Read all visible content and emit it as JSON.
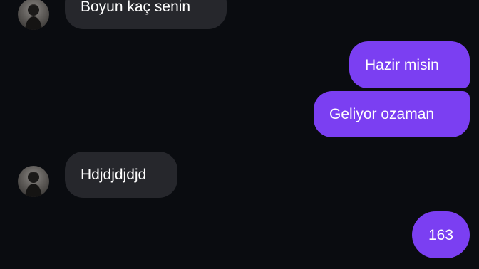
{
  "conversation": {
    "messages": [
      {
        "direction": "incoming",
        "text": "Boyun kaç senin"
      },
      {
        "direction": "outgoing",
        "text": "Hazir misin"
      },
      {
        "direction": "outgoing",
        "text": "Geliyor ozaman"
      },
      {
        "direction": "incoming",
        "text": "Hdjdjdjdjd"
      },
      {
        "direction": "outgoing",
        "text": "163"
      }
    ]
  },
  "colors": {
    "background": "#0a0c10",
    "incoming_bubble": "#26272c",
    "outgoing_bubble": "#7b3ff2",
    "text": "#ffffff"
  },
  "icons": {
    "avatar": "sender-profile-photo"
  }
}
